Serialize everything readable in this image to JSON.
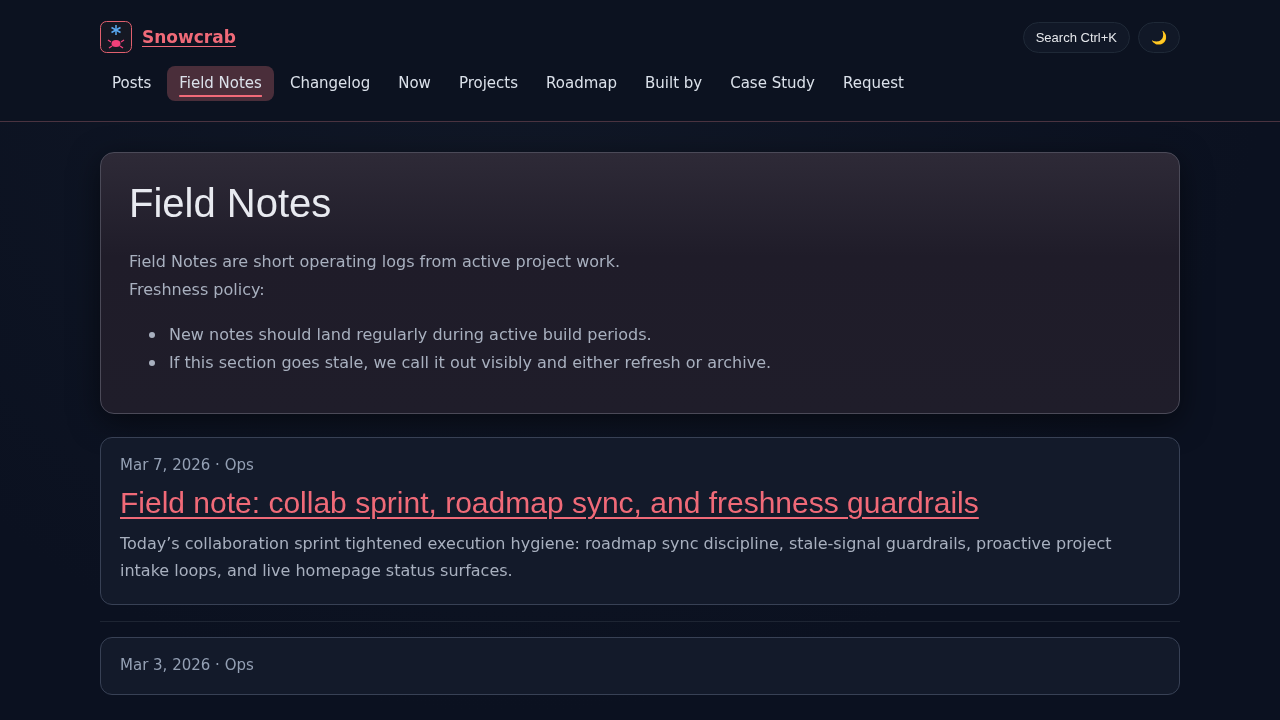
{
  "site": {
    "name": "Snowcrab"
  },
  "header_actions": {
    "search": "Search Ctrl+K",
    "theme_toggle": "🌙"
  },
  "nav": [
    {
      "label": "Posts",
      "selected": false
    },
    {
      "label": "Field Notes",
      "selected": true
    },
    {
      "label": "Changelog",
      "selected": false
    },
    {
      "label": "Now",
      "selected": false
    },
    {
      "label": "Projects",
      "selected": false
    },
    {
      "label": "Roadmap",
      "selected": false
    },
    {
      "label": "Built by",
      "selected": false
    },
    {
      "label": "Case Study",
      "selected": false
    },
    {
      "label": "Request",
      "selected": false
    }
  ],
  "hero": {
    "title": "Field Notes",
    "lines": [
      "Field Notes are short operating logs from active project work.",
      "Freshness policy:"
    ],
    "bullets": [
      "New notes should land regularly during active build periods.",
      "If this section goes stale, we call it out visibly and either refresh or archive."
    ]
  },
  "posts": [
    {
      "meta": "Mar 7, 2026 · Ops",
      "title": "Field note: collab sprint, roadmap sync, and freshness guardrails",
      "summary": "Today’s collaboration sprint tightened execution hygiene: roadmap sync discipline, stale-signal guardrails, proactive project intake loops, and live homepage status surfaces."
    },
    {
      "meta": "Mar 3, 2026 · Ops"
    }
  ]
}
